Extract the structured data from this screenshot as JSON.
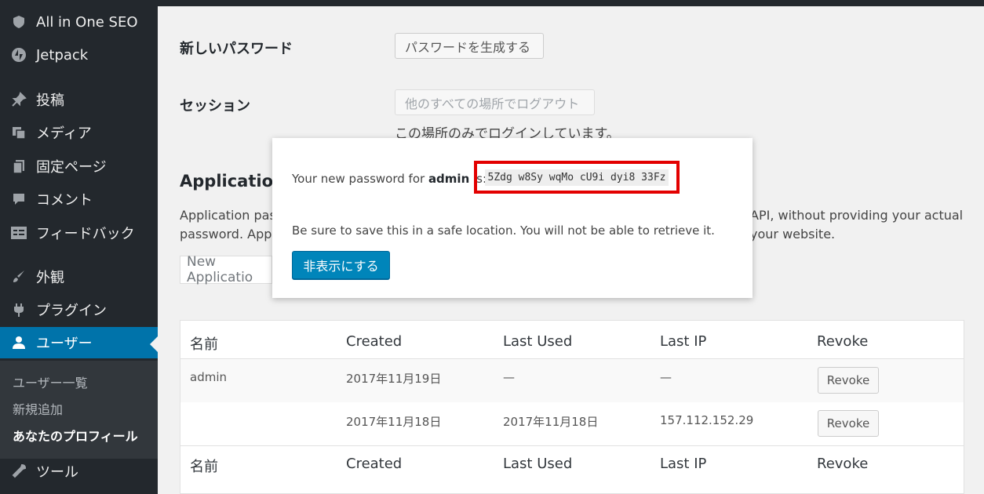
{
  "sidebar": {
    "items": [
      {
        "label": "All in One SEO",
        "icon": "shield-icon"
      },
      {
        "label": "Jetpack",
        "icon": "jetpack-icon"
      },
      {
        "label": "投稿",
        "icon": "pin-icon"
      },
      {
        "label": "メディア",
        "icon": "media-icon"
      },
      {
        "label": "固定ページ",
        "icon": "pages-icon"
      },
      {
        "label": "コメント",
        "icon": "comment-icon"
      },
      {
        "label": "フィードバック",
        "icon": "feedback-icon"
      },
      {
        "label": "外観",
        "icon": "brush-icon"
      },
      {
        "label": "プラグイン",
        "icon": "plugin-icon"
      },
      {
        "label": "ユーザー",
        "icon": "user-icon"
      },
      {
        "label": "ツール",
        "icon": "wrench-icon"
      }
    ],
    "submenu": [
      "ユーザー一覧",
      "新規追加",
      "あなたのプロフィール"
    ]
  },
  "profile": {
    "new_password_label": "新しいパスワード",
    "generate_password_button": "パスワードを生成する",
    "sessions_label": "セッション",
    "logout_everywhere_button": "他のすべての場所でログアウト",
    "sessions_note": "この場所のみでログインしています。",
    "app_passwords_title": "Application",
    "app_desc_left_1": "Application pass",
    "app_desc_left_2": "password. Applic",
    "app_desc_right_1": "API, without providing your actual",
    "app_desc_right_2": "your website.",
    "new_app_placeholder": "New Applicatio"
  },
  "table": {
    "headers": [
      "名前",
      "Created",
      "Last Used",
      "Last IP",
      "Revoke"
    ],
    "rows": [
      {
        "name": "admin",
        "created": "2017年11月19日",
        "last_used": "—",
        "last_ip": "—",
        "revoke": "Revoke"
      },
      {
        "name": "",
        "created": "2017年11月18日",
        "last_used": "2017年11月18日",
        "last_ip": "157.112.152.29",
        "revoke": "Revoke"
      }
    ],
    "footer": [
      "名前",
      "Created",
      "Last Used",
      "Last IP",
      "Revoke"
    ]
  },
  "modal": {
    "prefix": "Your new password for ",
    "username": "admin",
    "suffix": " is:",
    "password": "5Zdg w8Sy wqMo cU9i dyi8 33Fz",
    "warning": "Be sure to save this in a safe location. You will not be able to retrieve it.",
    "hide_button": "非表示にする"
  },
  "colors": {
    "sidebar_bg": "#23282d",
    "accent": "#0073aa",
    "primary_button": "#0085ba",
    "highlight_box": "#e30000"
  }
}
